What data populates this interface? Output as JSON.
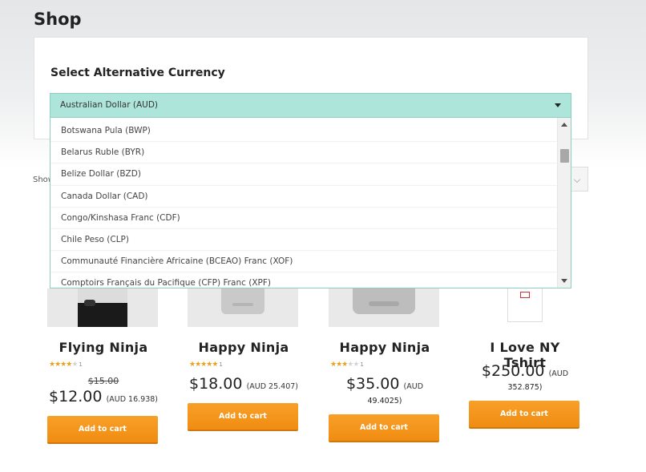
{
  "page": {
    "title": "Shop"
  },
  "currency_switcher": {
    "heading": "Select Alternative Currency",
    "selected": "Australian Dollar (AUD)",
    "options": [
      "Botswana Pula (BWP)",
      "Belarus Ruble (BYR)",
      "Belize Dollar (BZD)",
      "Canada Dollar (CAD)",
      "Congo/Kinshasa Franc (CDF)",
      "Chile Peso (CLP)",
      "Communauté Financière Africaine (BCEAO) Franc (XOF)",
      "Comptoirs Français du Pacifique (CFP) Franc (XPF)"
    ]
  },
  "toolbar": {
    "showing_text": "Show"
  },
  "colors": {
    "accent": "#f39019",
    "select_bg": "#ade5da",
    "star": "#e9a11b"
  },
  "products": [
    {
      "name": "Flying Ninja",
      "rating": 4,
      "rating_count": "1",
      "old_price": "$15.00",
      "price": "$12.00",
      "alt_price_line1": "(AUD 16.938)",
      "alt_price_line2": "",
      "button": "Add to cart"
    },
    {
      "name": "Happy Ninja",
      "rating": 5,
      "rating_count": "1",
      "old_price": "",
      "price": "$18.00",
      "alt_price_line1": "(AUD 25.407)",
      "alt_price_line2": "",
      "button": "Add to cart"
    },
    {
      "name": "Happy Ninja",
      "rating": 3,
      "rating_count": "1",
      "old_price": "",
      "price": "$35.00",
      "alt_price_line1": "(AUD",
      "alt_price_line2": "49.4025)",
      "button": "Add to cart"
    },
    {
      "name": "I Love NY Tshirt",
      "rating": 0,
      "rating_count": "",
      "old_price": "",
      "price": "$250.00",
      "alt_price_line1": "(AUD",
      "alt_price_line2": "352.875)",
      "button": "Add to cart"
    }
  ]
}
